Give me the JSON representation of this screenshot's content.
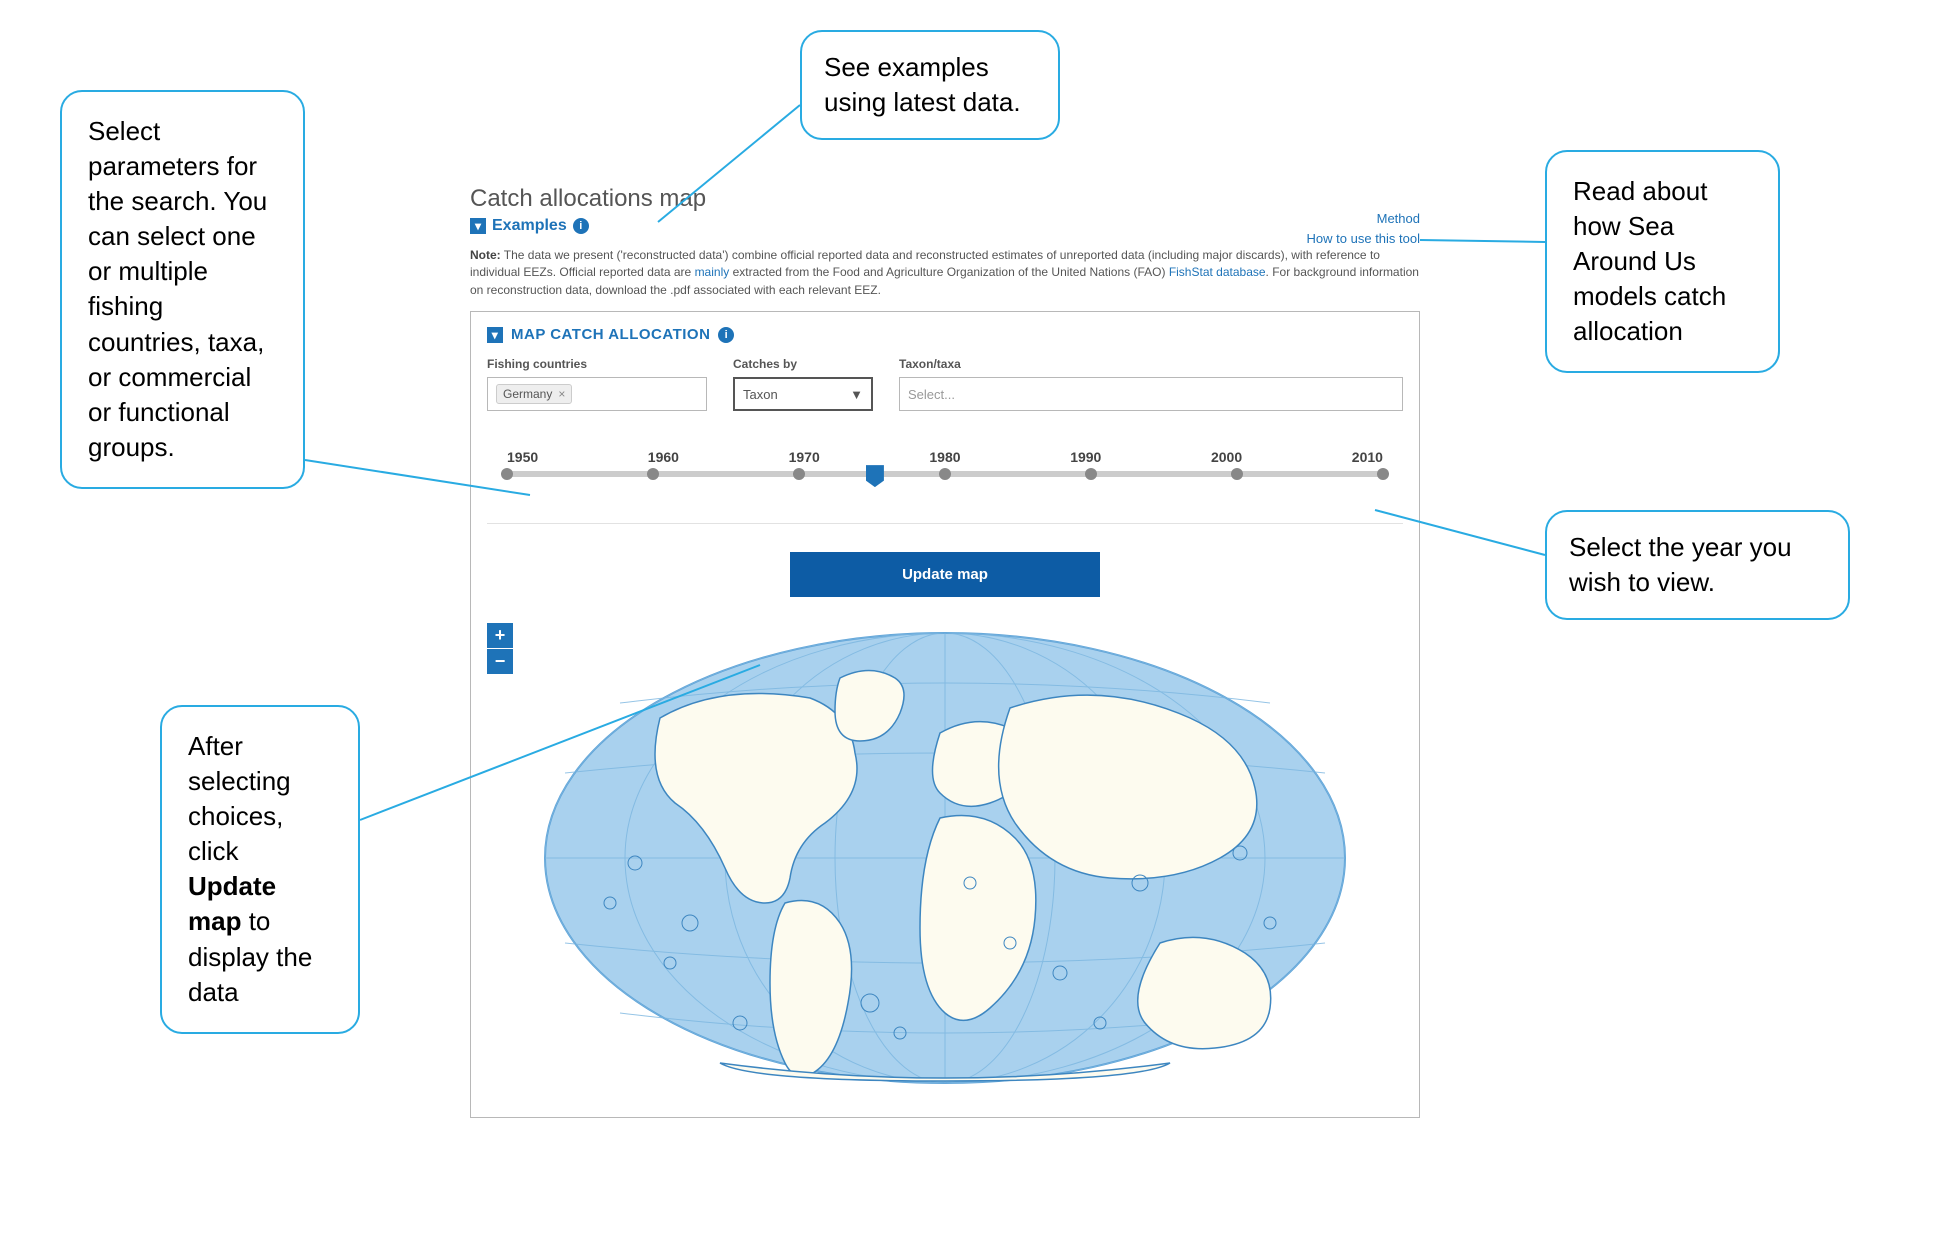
{
  "callouts": {
    "select_params": "Select parameters for the search. You can select one or multiple fishing countries, taxa, or commercial or functional groups.",
    "see_examples": "See examples using latest data.",
    "read_about": "Read about how Sea Around Us models catch allocation",
    "select_year": "Select the year you wish to view.",
    "update_map": "After selecting choices, click Update map to display the data"
  },
  "app": {
    "title": "Catch allocations map",
    "examples_label": "Examples",
    "right_links": {
      "method": "Method",
      "howto": "How to use this tool"
    },
    "note": {
      "bold": "Note:",
      "part1": " The data we present ('reconstructed data') combine official reported data and reconstructed estimates of unreported data (including major discards), with reference to individual EEZs. Official reported data are ",
      "mainly": "mainly",
      "part2": " extracted from the Food and Agriculture Organization of the United Nations (FAO) ",
      "fishstat": "FishStat database",
      "part3": ". For background information on reconstruction data, download the .pdf associated with each relevant EEZ."
    },
    "card": {
      "header": "MAP CATCH ALLOCATION",
      "fields": {
        "fishing_countries": {
          "label": "Fishing countries",
          "tag": "Germany"
        },
        "catches_by": {
          "label": "Catches by",
          "value": "Taxon"
        },
        "taxon": {
          "label": "Taxon/taxa",
          "placeholder": "Select..."
        }
      },
      "years": [
        "1950",
        "1960",
        "1970",
        "1980",
        "1990",
        "2000",
        "2010"
      ],
      "slider_index": 3,
      "update": "Update map"
    },
    "zoom": {
      "plus": "+",
      "minus": "−"
    }
  }
}
